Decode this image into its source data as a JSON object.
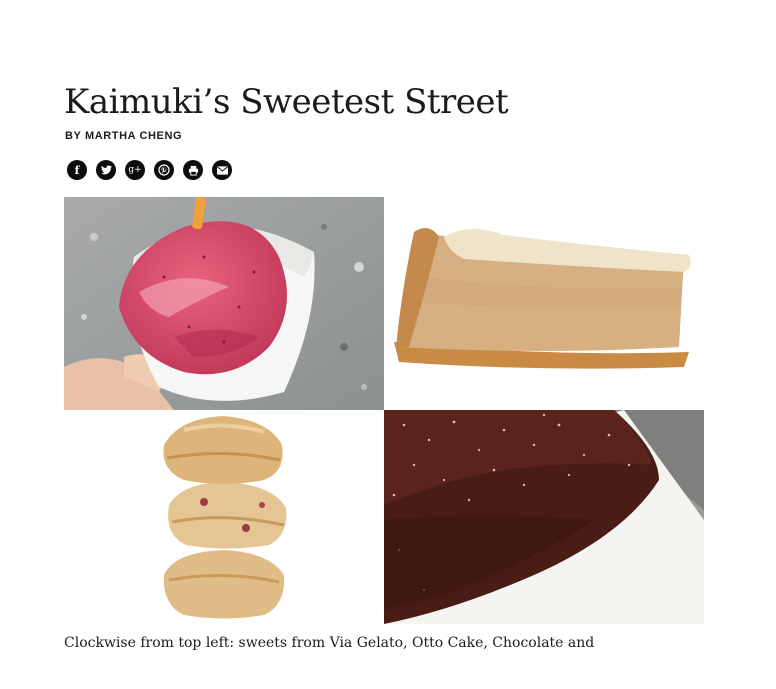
{
  "article": {
    "title": "Kaimuki’s Sweetest Street",
    "byline": "BY MARTHA CHENG",
    "caption": "Clockwise from top left: sweets from Via Gelato, Otto Cake, Chocolate and"
  },
  "share": [
    {
      "icon": "facebook-icon",
      "glyph": "f"
    },
    {
      "icon": "twitter-icon",
      "glyph": ""
    },
    {
      "icon": "google-plus-icon",
      "glyph": "g+"
    },
    {
      "icon": "pinterest-icon",
      "glyph": "p"
    },
    {
      "icon": "print-icon",
      "glyph": ""
    },
    {
      "icon": "email-icon",
      "glyph": ""
    }
  ],
  "colors": {
    "text": "#1b1b1b",
    "share_button": "#0c0c0c",
    "background": "#ffffff"
  }
}
